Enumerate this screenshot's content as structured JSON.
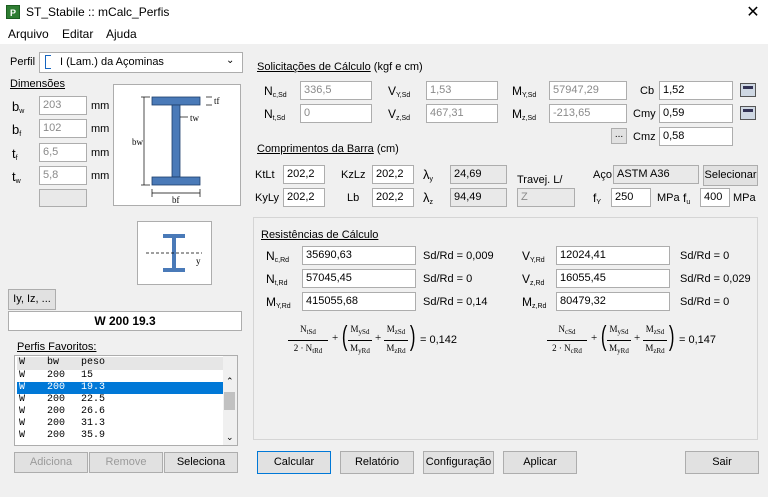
{
  "window": {
    "title": "ST_Stabile :: mCalc_Perfis",
    "icon_letter": "P",
    "close_glyph": "✕"
  },
  "menu": [
    "Arquivo",
    "Editar",
    "Ajuda"
  ],
  "left": {
    "perfil_label": "Perfil",
    "perfil_value": "I (Lam.) da Açominas",
    "dimensoes_label": "Dimensões",
    "dims": [
      {
        "sym": "b",
        "sub": "w",
        "value": "203",
        "unit": "mm"
      },
      {
        "sym": "b",
        "sub": "f",
        "value": "102",
        "unit": "mm"
      },
      {
        "sym": "t",
        "sub": "f",
        "value": "6,5",
        "unit": "mm"
      },
      {
        "sym": "t",
        "sub": "w",
        "value": "5,8",
        "unit": "mm"
      }
    ],
    "diagram": {
      "tf": "tf",
      "tw": "tw",
      "bw": "bw",
      "bf": "bf"
    },
    "axis": "y",
    "iyiz_button": "Iy, Iz, ...",
    "profile_name": "W 200 19.3",
    "favoritos_label": "Perfis Favoritos:",
    "fav_headers": [
      "W",
      "bw",
      "peso"
    ],
    "fav_rows": [
      [
        "W",
        "200",
        "15"
      ],
      [
        "W",
        "200",
        "19.3"
      ],
      [
        "W",
        "200",
        "22.5"
      ],
      [
        "W",
        "200",
        "26.6"
      ],
      [
        "W",
        "200",
        "31.3"
      ],
      [
        "W",
        "200",
        "35.9"
      ]
    ],
    "fav_selected": 1,
    "btn_adiciona": "Adiciona",
    "btn_remove": "Remove",
    "btn_seleciona": "Seleciona"
  },
  "solic": {
    "title": "Solicitações de Cálculo",
    "units": "(kgf e cm)",
    "ncsd": {
      "s": "N",
      "sub": "c,Sd",
      "v": "336,5"
    },
    "ntsd": {
      "s": "N",
      "sub": "t,Sd",
      "v": "0"
    },
    "vysd": {
      "s": "V",
      "sub": "Y,Sd",
      "v": "1,53"
    },
    "vzsd": {
      "s": "V",
      "sub": "z,Sd",
      "v": "467,31"
    },
    "mysd": {
      "s": "M",
      "sub": "Y,Sd",
      "v": "57947,29"
    },
    "mzsd": {
      "s": "M",
      "sub": "z,Sd",
      "v": "-213,65"
    },
    "cb": {
      "label": "Cb",
      "v": "1,52"
    },
    "cmy": {
      "label": "Cmy",
      "v": "0,59"
    },
    "cmz": {
      "label": "Cmz",
      "v": "0,58"
    },
    "small_btn": "..."
  },
  "comp": {
    "title": "Comprimentos da Barra",
    "units": "(cm)",
    "ktlt": {
      "label": "KtLt",
      "v": "202,2"
    },
    "kzlz": {
      "label": "KzLz",
      "v": "202,2"
    },
    "kyly": {
      "label": "KyLy",
      "v": "202,2"
    },
    "lb": {
      "label": "Lb",
      "v": "202,2"
    },
    "lambda_y": {
      "label": "y",
      "v": "24,69"
    },
    "lambda_z": {
      "label": "z",
      "v": "94,49"
    },
    "travej_label": "Travej. L/",
    "travej_v": "Z",
    "aco_label": "Aço",
    "aco_v": "ASTM A36",
    "selecionar": "Selecionar",
    "fy_label": "f",
    "fy_sub": "Y",
    "fy_v": "250",
    "mpa1": "MPa",
    "fu_label": "f",
    "fu_sub": "u",
    "fu_v": "400",
    "mpa2": "MPa"
  },
  "resist": {
    "title": "Resistências de Cálculo",
    "rows": [
      {
        "l": {
          "s": "N",
          "sub": "c,Rd",
          "v": "35690,63",
          "r": "Sd/Rd = 0,009"
        },
        "r": {
          "s": "V",
          "sub": "Y,Rd",
          "v": "12024,41",
          "r": "Sd/Rd = 0"
        }
      },
      {
        "l": {
          "s": "N",
          "sub": "t,Rd",
          "v": "57045,45",
          "r": "Sd/Rd = 0"
        },
        "r": {
          "s": "V",
          "sub": "z,Rd",
          "v": "16055,45",
          "r": "Sd/Rd = 0,029"
        }
      },
      {
        "l": {
          "s": "M",
          "sub": "Y,Rd",
          "v": "415055,68",
          "r": "Sd/Rd = 0,14"
        },
        "r": {
          "s": "M",
          "sub": "z,Rd",
          "v": "80479,32",
          "r": "Sd/Rd = 0"
        }
      }
    ],
    "f1": {
      "num": "N",
      "numsub": "tSd",
      "den": "2 · N",
      "densub": "tRd",
      "m1n": "M",
      "m1ns": "ySd",
      "m1d": "M",
      "m1ds": "yRd",
      "m2n": "M",
      "m2ns": "zSd",
      "m2d": "M",
      "m2ds": "zRd",
      "res": "= 0,142"
    },
    "f2": {
      "num": "N",
      "numsub": "cSd",
      "den": "2 · N",
      "densub": "cRd",
      "m1n": "M",
      "m1ns": "ySd",
      "m1d": "M",
      "m1ds": "yRd",
      "m2n": "M",
      "m2ns": "zSd",
      "m2d": "M",
      "m2ds": "zRd",
      "res": "= 0,147"
    }
  },
  "bottom": {
    "calcular": "Calcular",
    "relatorio": "Relatório",
    "configuracao": "Configuração",
    "aplicar": "Aplicar",
    "sair": "Sair"
  }
}
